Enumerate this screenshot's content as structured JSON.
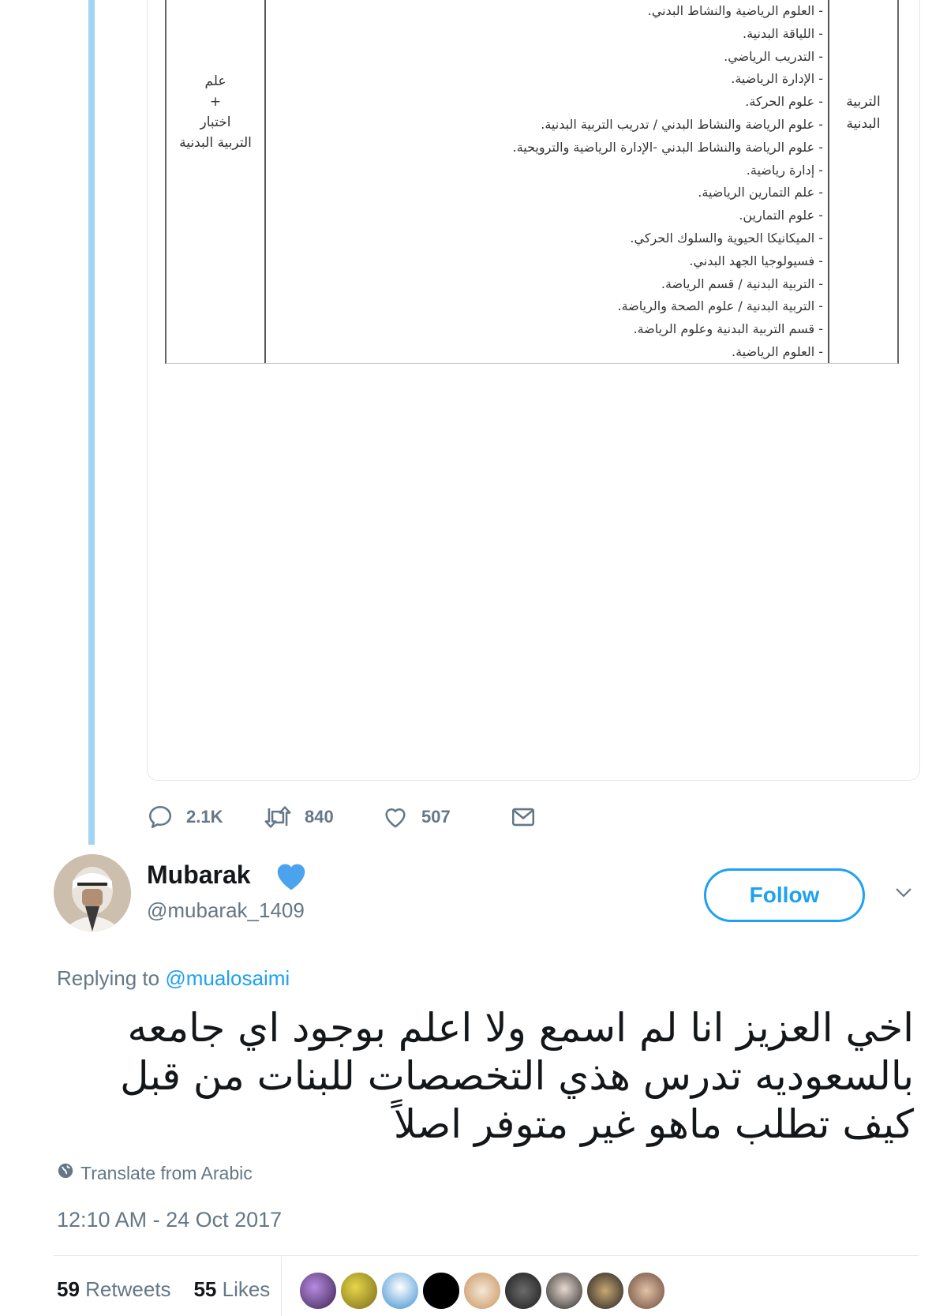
{
  "embedded_image": {
    "left_column_lines": [
      "علم",
      "+",
      "اختبار",
      "التربية البدنية"
    ],
    "right_column_lines": [
      "التربية",
      "البدنية"
    ],
    "items": [
      "- العلوم الرياضية والنشاط البدني.",
      "- اللياقة البدنية.",
      "- التدريب الرياضي.",
      "- الإدارة الرياضية.",
      "- علوم الحركة.",
      "- علوم الرياضة والنشاط البدني / تدريب التربية البدنية.",
      "- علوم الرياضة والنشاط البدني -الإدارة الرياضية والترويحية.",
      "- إدارة رياضية.",
      "- علم التمارين الرياضية.",
      "- علوم التمارين.",
      "- الميكانيكا الحيوية والسلوك الحركي.",
      "- فسيولوجيا الجهد البدني.",
      "- التربية البدنية / قسم الرياضة.",
      "- التربية البدنية / علوم الصحة والرياضة.",
      "- قسم التربية البدنية وعلوم الرياضة.",
      "- العلوم الرياضية."
    ]
  },
  "parent_actions": {
    "replies": "2.1K",
    "retweets": "840",
    "likes": "507"
  },
  "tweet": {
    "name": "Mubarak",
    "handle": "@mubarak_1409",
    "follow_label": "Follow",
    "replying_prefix": "Replying to",
    "replying_to": "@mualosaimi",
    "text": "اخي العزيز انا لم اسمع ولا اعلم بوجود اي جامعه بالسعوديه تدرس هذي التخصصات للبنات من قبل كيف تطلب ماهو غير متوفر اصلاً",
    "translate_label": "Translate from Arabic",
    "timestamp": "12:10 AM - 24 Oct 2017",
    "retweet_count": "59",
    "retweet_label": "Retweets",
    "like_count": "55",
    "like_label": "Likes"
  },
  "colors": {
    "accent": "#1da1f2",
    "thread_line": "#a4d4f5",
    "muted": "#657786",
    "verified": "#4aa3ec"
  },
  "icons": [
    "reply-icon",
    "retweet-icon",
    "like-icon",
    "message-icon",
    "verified-badge-icon",
    "chevron-down-icon",
    "globe-icon"
  ]
}
